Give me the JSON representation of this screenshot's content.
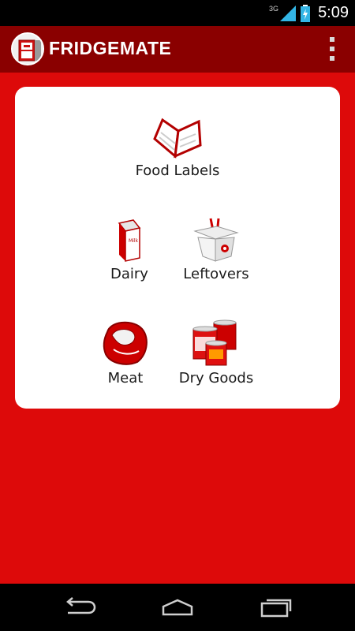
{
  "status_bar": {
    "network": "3G",
    "time": "5:09",
    "icons": [
      "signal-icon",
      "battery-charging-icon"
    ]
  },
  "app": {
    "title": "FRIDGEMATE",
    "logo_icon": "fridge-logo-icon",
    "menu_icon": "overflow-menu-icon"
  },
  "categories": [
    {
      "label": "Food Labels",
      "icon": "open-book-icon"
    },
    {
      "label": "Dairy",
      "icon": "milk-carton-icon"
    },
    {
      "label": "Leftovers",
      "icon": "takeout-box-icon"
    },
    {
      "label": "Meat",
      "icon": "steak-icon"
    },
    {
      "label": "Dry Goods",
      "icon": "canned-goods-icon"
    }
  ],
  "nav": {
    "buttons": [
      "back-icon",
      "home-icon",
      "recent-apps-icon"
    ]
  },
  "colors": {
    "action_bar": "#8a0000",
    "background": "#dd0a0a",
    "card": "#ffffff"
  }
}
